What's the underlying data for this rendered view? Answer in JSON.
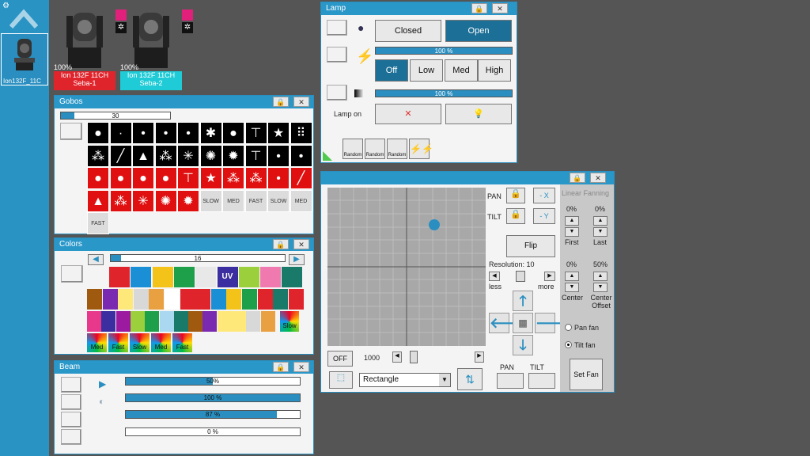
{
  "sidebar": {
    "selected_label": "Ion132F_11C"
  },
  "fixtures": [
    {
      "pct": "100%",
      "name": "Ion 132F 11CH",
      "sub": "Seba-1",
      "color": "#e0242c"
    },
    {
      "pct": "100%",
      "name": "Ion 132F 11CH",
      "sub": "Seba-2",
      "color": "#1ecbd6"
    }
  ],
  "lamp": {
    "title": "Lamp",
    "closed": "Closed",
    "open": "Open",
    "bar1": "100 %",
    "off": "Off",
    "low": "Low",
    "med": "Med",
    "high": "High",
    "bar2": "100 %",
    "lamp_on": "Lamp on",
    "random": [
      "Random",
      "Random",
      "Random"
    ]
  },
  "gobos": {
    "title": "Gobos",
    "value": "30",
    "rot": [
      "SLOW",
      "MED",
      "FAST",
      "SLOW",
      "MED",
      "FAST"
    ]
  },
  "colors": {
    "title": "Colors",
    "value": "16",
    "uv": "UV",
    "slow": "Slow",
    "wheel": [
      "Med",
      "Fast",
      "Slow",
      "Med",
      "Fast"
    ],
    "row1": [
      "#e0242c",
      "#1a8fd6",
      "#f4c31a",
      "#1ea04a",
      "#e8e8e8",
      "#3a2ea0",
      "#9bd03c",
      "#f07ab0",
      "#1a7a6a"
    ],
    "row2": [
      "#a05a10",
      "#7a2ab0",
      "#ffe87a",
      "#d8d8d8",
      "#e8a040",
      "#ffffff",
      "#e0242c",
      "#e0242c",
      "#1a8fd6",
      "#f4c31a",
      "#1ea04a",
      "#e0242c",
      "#1a7a6a",
      "#e0242c"
    ],
    "row3": [
      "#e8388c",
      "#3a2ea0",
      "#9b1aa0",
      "#9bd03c",
      "#1ea04a",
      "#aad8f0",
      "#1a7a6a",
      "#a05a10",
      "#7a2ab0",
      "#ffe87a",
      "#ffe87a",
      "#d8d8d8",
      "#e8a040"
    ]
  },
  "beam": {
    "title": "Beam",
    "bars": [
      "50%",
      "100 %",
      "87 %",
      "0 %"
    ],
    "levels": [
      0.5,
      1,
      0.87,
      0
    ]
  },
  "pantilt": {
    "pan": "PAN",
    "tilt": "TILT",
    "minus_x": "- X",
    "minus_y": "- Y",
    "flip": "Flip",
    "resolution": "Resolution: 10",
    "less": "less",
    "more": "more",
    "off": "OFF",
    "speed": "1000",
    "shape": "Rectangle",
    "pan_lbl": "PAN",
    "tilt_lbl": "TILT",
    "fan_title": "Linear Fanning",
    "first_pct": "0%",
    "last_pct": "0%",
    "first": "First",
    "last": "Last",
    "center_pct": "0%",
    "offset_pct": "50%",
    "center": "Center",
    "offset": "Center Offset",
    "pan_fan": "Pan fan",
    "tilt_fan": "Tilt fan",
    "set_fan": "Set Fan"
  }
}
